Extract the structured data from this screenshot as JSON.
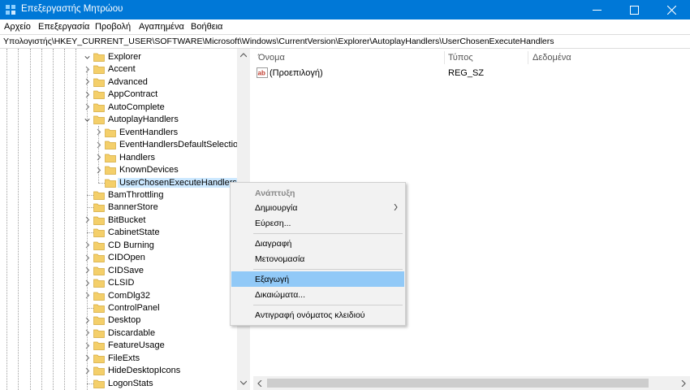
{
  "window": {
    "title": "Επεξεργαστής Μητρώου",
    "app_icon": "registry-editor-icon",
    "titlebar_color": "#0078d7"
  },
  "menu": [
    "Αρχείο",
    "Επεξεργασία",
    "Προβολή",
    "Αγαπημένα",
    "Βοήθεια"
  ],
  "address": "Υπολογιστής\\HKEY_CURRENT_USER\\SOFTWARE\\Microsoft\\Windows\\CurrentVersion\\Explorer\\AutoplayHandlers\\UserChosenExecuteHandlers",
  "tree": [
    {
      "label": "Explorer",
      "expanded": true
    },
    {
      "label": "Accent",
      "expanded": false
    },
    {
      "label": "Advanced",
      "expanded": false
    },
    {
      "label": "AppContract",
      "expanded": false
    },
    {
      "label": "AutoComplete",
      "expanded": false
    },
    {
      "label": "AutoplayHandlers",
      "expanded": true
    },
    {
      "label": "EventHandlers",
      "expanded": false
    },
    {
      "label": "EventHandlersDefaultSelection",
      "expanded": false
    },
    {
      "label": "Handlers",
      "expanded": false
    },
    {
      "label": "KnownDevices",
      "expanded": false
    },
    {
      "label": "UserChosenExecuteHandlers",
      "selected": true
    },
    {
      "label": "BamThrottling"
    },
    {
      "label": "BannerStore"
    },
    {
      "label": "BitBucket",
      "expanded": false
    },
    {
      "label": "CabinetState"
    },
    {
      "label": "CD Burning",
      "expanded": false
    },
    {
      "label": "CIDOpen",
      "expanded": false
    },
    {
      "label": "CIDSave",
      "expanded": false
    },
    {
      "label": "CLSID",
      "expanded": false
    },
    {
      "label": "ComDlg32",
      "expanded": false
    },
    {
      "label": "ControlPanel"
    },
    {
      "label": "Desktop",
      "expanded": false
    },
    {
      "label": "Discardable",
      "expanded": false
    },
    {
      "label": "FeatureUsage",
      "expanded": false
    },
    {
      "label": "FileExts",
      "expanded": false
    },
    {
      "label": "HideDesktopIcons",
      "expanded": false
    },
    {
      "label": "LogonStats"
    }
  ],
  "values_pane": {
    "columns": {
      "name": "Όνομα",
      "type": "Τύπος",
      "data": "Δεδομένα"
    },
    "rows": [
      {
        "icon": "string-value-icon",
        "name": "(Προεπιλογή)",
        "type": "REG_SZ",
        "data": ""
      }
    ]
  },
  "context_menu": {
    "items": [
      {
        "label": "Ανάπτυξη",
        "kind": "bold"
      },
      {
        "label": "Δημιουργία",
        "kind": "submenu"
      },
      {
        "label": "Εύρεση...",
        "kind": "item"
      },
      {
        "kind": "separator"
      },
      {
        "label": "Διαγραφή",
        "kind": "item"
      },
      {
        "label": "Μετονομασία",
        "kind": "item"
      },
      {
        "kind": "separator"
      },
      {
        "label": "Εξαγωγή",
        "kind": "highlighted"
      },
      {
        "label": "Δικαιώματα...",
        "kind": "item"
      },
      {
        "kind": "separator"
      },
      {
        "label": "Αντιγραφή ονόματος κλειδιού",
        "kind": "item"
      }
    ],
    "highlight_color": "#91c9f7"
  },
  "colors": {
    "folder": "#f4cf6a",
    "selection": "#cce8ff"
  }
}
